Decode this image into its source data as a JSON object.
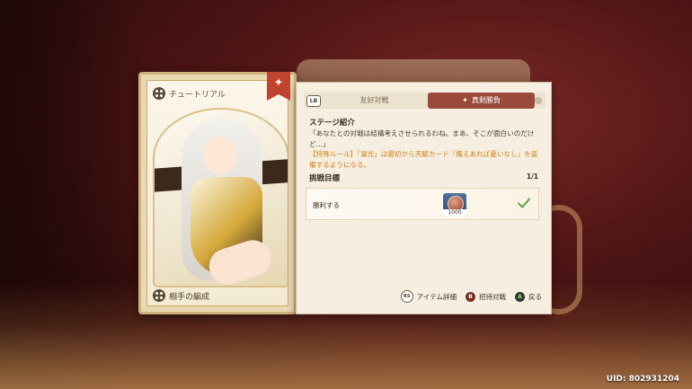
{
  "card": {
    "top_label": "チュートリアル",
    "bottom_label": "相手の編成",
    "ribbon_icon": "star-icon",
    "accent": "#c0432f"
  },
  "tabs": {
    "lb": "LB",
    "items": [
      {
        "label": "友好対戦",
        "active": false
      },
      {
        "label": "真剣勝負",
        "active": true
      }
    ]
  },
  "stage": {
    "title": "ステージ紹介",
    "quote": "「あなたとの対戦は結構考えさせられるわね。まあ、そこが面白いのだけど…」",
    "rule": "【特殊ルール】「凝光」は最初から天賦カード「備えあれば憂いなし」を装備するようになる。"
  },
  "goal": {
    "title": "挑戦目標",
    "counter": "1/1",
    "label": "勝利する",
    "reward_count": "1000",
    "status_icon": "check-icon"
  },
  "footer": {
    "item_detail_key": "RS",
    "item_detail": "アイテム詳細",
    "invite_key": "B",
    "invite": "招待対戦",
    "back_key": "A",
    "back": "戻る"
  },
  "uid": "UID: 802931204"
}
